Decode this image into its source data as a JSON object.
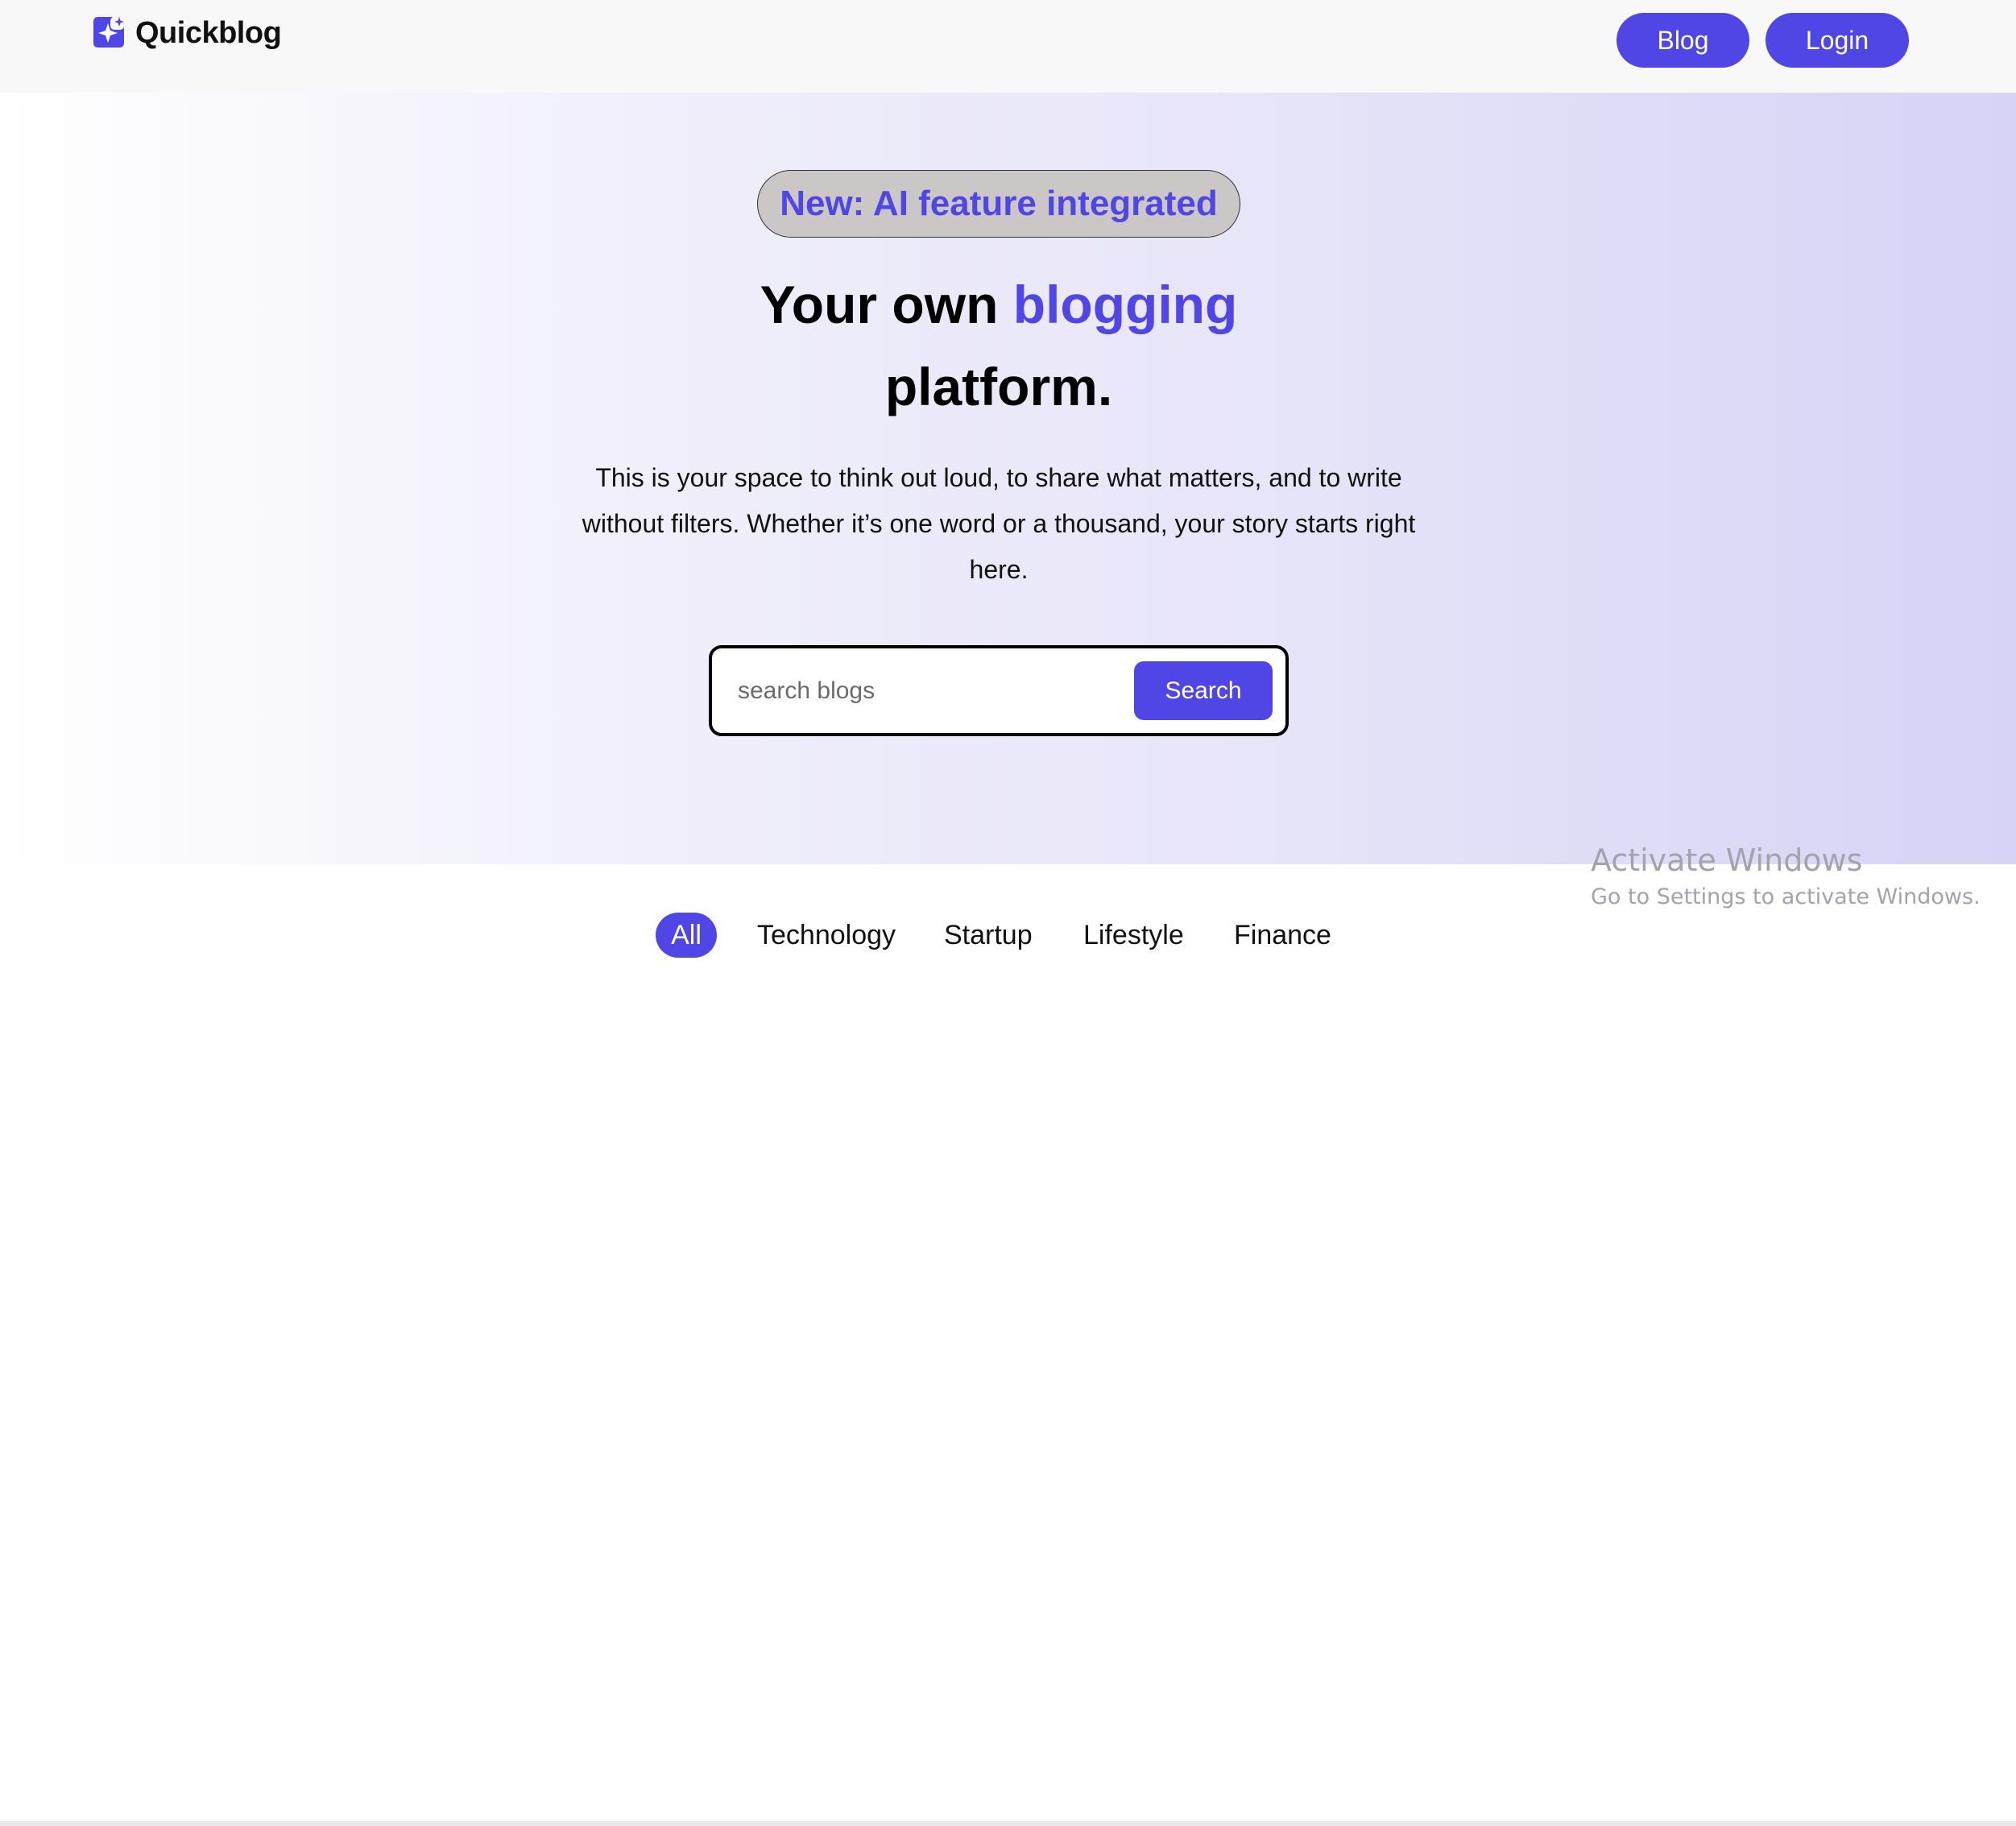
{
  "header": {
    "brand_name": "Quickblog",
    "logo_icon": "sparkle-icon",
    "nav": [
      {
        "label": "Blog"
      },
      {
        "label": "Login"
      }
    ]
  },
  "hero": {
    "badge": "New: AI feature integrated",
    "headline_start": "Your own ",
    "headline_accent": "blogging",
    "headline_end": "platform.",
    "lead_lines": [
      "This is your space to think out loud, to share what matters, and to write",
      "without filters. Whether it’s one word or a thousand, your story starts right",
      "here."
    ],
    "search": {
      "placeholder": "search blogs",
      "value": "",
      "button_label": "Search"
    }
  },
  "categories": {
    "items": [
      "All",
      "Technology",
      "Startup",
      "Lifestyle",
      "Finance"
    ],
    "active": "All"
  },
  "watermark": {
    "title": "Activate Windows",
    "subtitle": "Go to Settings to activate Windows."
  },
  "colors": {
    "accent": "#4f46e5",
    "badge_bg": "#cbc7c7",
    "header_bg": "#f8f8f9"
  }
}
